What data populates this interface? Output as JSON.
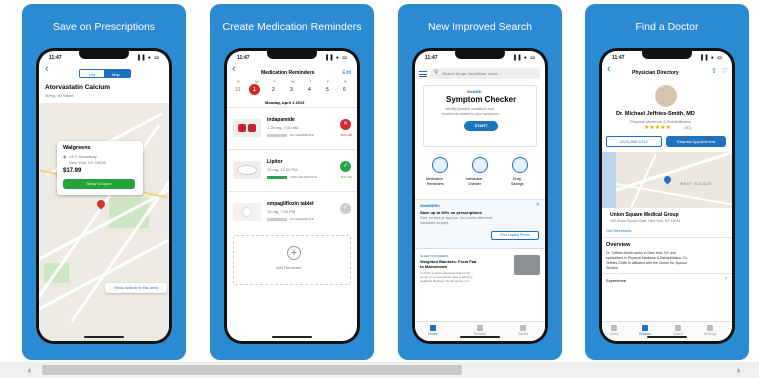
{
  "cards": [
    {
      "caption": "Save on Prescriptions"
    },
    {
      "caption": "Create Medication Reminders"
    },
    {
      "caption": "New Improved Search"
    },
    {
      "caption": "Find a Doctor"
    }
  ],
  "status": {
    "time": "11:47",
    "icons": "▐▐ ● ▭"
  },
  "rx": {
    "back": "‹",
    "seg_list": "List",
    "seg_map": "Map",
    "drug": "Atorvastatin Calcium",
    "dose": "40mg, 30 Tablet",
    "pharmacy": "Walgreens",
    "addr1": "1471 Broadway",
    "addr2": "New York, NY 10036",
    "price": "$17.99",
    "coupon": "Show Coupon",
    "redo": "Redo search in this area"
  },
  "rem": {
    "back": "‹",
    "title": "Medication Reminders",
    "edit": "Edit",
    "days": [
      "S",
      "M",
      "T",
      "W",
      "T",
      "F",
      "S"
    ],
    "dates": [
      "31",
      "1",
      "2",
      "3",
      "4",
      "5",
      "6"
    ],
    "selected": "Monday, April 1 2019",
    "meds": [
      {
        "name": "indapamide",
        "sig": "1.25 mg, 7:00 AM",
        "adh": "0% ADHERENCE",
        "status": "5/21 Mis"
      },
      {
        "name": "Lipitor",
        "sig": "20 mg, 12:30 PM",
        "adh": "100% ADHERENCE",
        "status": "5/21 Tak"
      },
      {
        "name": "empagliflozin tablet",
        "sig": "10 mg, 7:00 PM",
        "adh": "0% ADHERENCE",
        "status": ""
      }
    ],
    "add": "Add Reminder"
  },
  "search": {
    "placeholder": "Search drugs, conditions, news...",
    "sc_brand": "WebMD",
    "sc_title": "Symptom Checker",
    "sc_desc1": "Identify possible conditions and",
    "sc_desc2": "treatments related to your symptoms",
    "start": "START",
    "tiles": [
      [
        "Medication",
        "Reminders"
      ],
      [
        "Interaction",
        "Checker"
      ],
      [
        "Drug",
        "Savings"
      ]
    ],
    "rx_brand": "WebMDRx",
    "rx_title": "Save up to 80% on prescriptions",
    "rx_desc1": "Free, no fees or signups. Our prices often beat",
    "rx_desc2": "insurance co-pays.",
    "rx_btn": "Find Lowest Prices",
    "close": "✕",
    "news_tag": "SLEEP DISORDERS",
    "news_title1": "Weighted Blankets: From Fad",
    "news_title2": "to Mainstream",
    "news_body1": "In 2018, experts estimated that a half-",
    "news_body2": "dozen or so companies were producing",
    "news_body3": "weighted blankets. By the spring of 2...",
    "tabs": [
      "Home",
      "Browse",
      "Saved"
    ]
  },
  "doc": {
    "back": "‹",
    "title": "Physician Directory",
    "name": "Dr. Michael Jeffries-Smith, MD",
    "spec": "Physical Medicine & Rehabilitation",
    "stars": "★★★★★",
    "reviews": "(30)",
    "phone": "(212) 555-1212",
    "appt": "Request Appointment",
    "map_label": "WEST VILLAGE",
    "group": "Union Square Medical Group",
    "gaddr": "150 Union Square East, New York, NY 10014",
    "directions": "Get Directions",
    "ov_h": "Overview",
    "ov1": "Dr. Jeffries-Smith works in New York, NY and",
    "ov2": "specializes in Physical Medicine & Rehabilitation. Dr.",
    "ov3": "Jeffries-Smith is affiliated with the Center for Special",
    "ov4": "Studies.",
    "exp": "Experience",
    "tabs": [
      "Home",
      "Doctors",
      "Saved",
      "Settings"
    ]
  },
  "scrollbar": {
    "left": "‹",
    "right": "›"
  }
}
